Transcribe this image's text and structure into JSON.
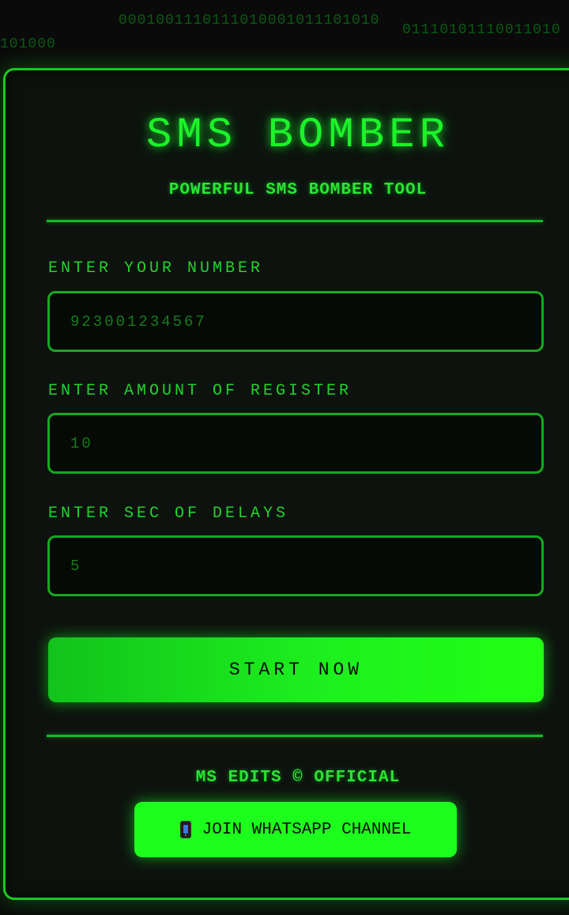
{
  "background_binary": [
    "0001001110111010001011101010",
    "101000",
    "01110101110011010"
  ],
  "header": {
    "title": "SMS BOMBER",
    "subtitle": "POWERFUL SMS BOMBER TOOL"
  },
  "form": {
    "number": {
      "label": "ENTER YOUR NUMBER",
      "placeholder": "923001234567",
      "value": ""
    },
    "amount": {
      "label": "ENTER AMOUNT OF REGISTER",
      "placeholder": "10",
      "value": ""
    },
    "delay": {
      "label": "ENTER SEC OF DELAYS",
      "placeholder": "5",
      "value": ""
    },
    "start_label": "START NOW"
  },
  "footer": {
    "credit": "MS EDITS © OFFICIAL",
    "whatsapp_label": "JOIN WHATSAPP CHANNEL",
    "whatsapp_icon": "mobile-phone-icon"
  },
  "colors": {
    "accent": "#1cf22a",
    "border": "#19c91f",
    "card_background": "#0d120e",
    "page_background": "#0a0a0a",
    "button_text": "#0a0a0a"
  }
}
